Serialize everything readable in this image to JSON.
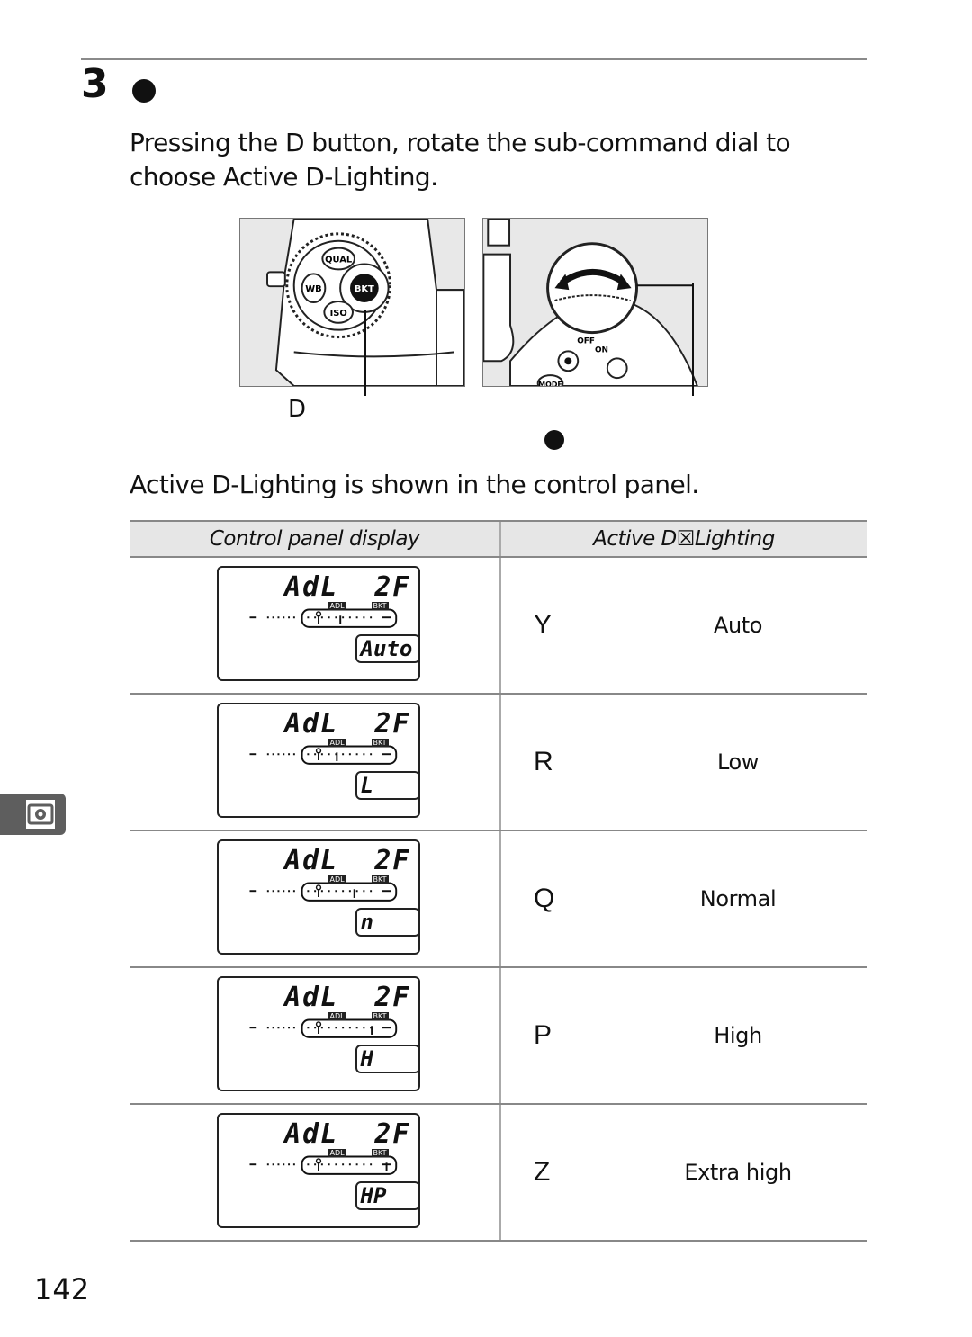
{
  "step": {
    "number": "3",
    "bullet_icon": "filled-circle",
    "instruction": "Pressing the D    button, rotate the sub-command dial to choose Active D-Lighting."
  },
  "illustrations": {
    "left": {
      "button_labels": [
        "QUAL",
        "WB",
        "BKT",
        "ISO"
      ],
      "callout_label": "D"
    },
    "right": {
      "dial_labels": [
        "OFF",
        "ON",
        "MODE"
      ],
      "callout_icon": "filled-circle"
    }
  },
  "caption": "Active D-Lighting is shown in the control panel.",
  "table": {
    "headers": [
      "Control panel display",
      "Active D☒Lighting"
    ],
    "rows": [
      {
        "lcd_top": "AdL  2F",
        "lcd_value": "Auto",
        "symbol": "Y",
        "label": "Auto"
      },
      {
        "lcd_top": "AdL  2F",
        "lcd_value": "L",
        "symbol": "R",
        "label": "Low"
      },
      {
        "lcd_top": "AdL  2F",
        "lcd_value": "n",
        "symbol": "Q",
        "label": "Normal"
      },
      {
        "lcd_top": "AdL  2F",
        "lcd_value": "H",
        "symbol": "P",
        "label": "High"
      },
      {
        "lcd_top": "AdL  2F",
        "lcd_value": "HP",
        "symbol": "Z",
        "label": "Extra high"
      }
    ],
    "lcd_tags": [
      "ADL",
      "BKT"
    ]
  },
  "side_tab": {
    "icon": "metering-icon"
  },
  "page_number": "142"
}
